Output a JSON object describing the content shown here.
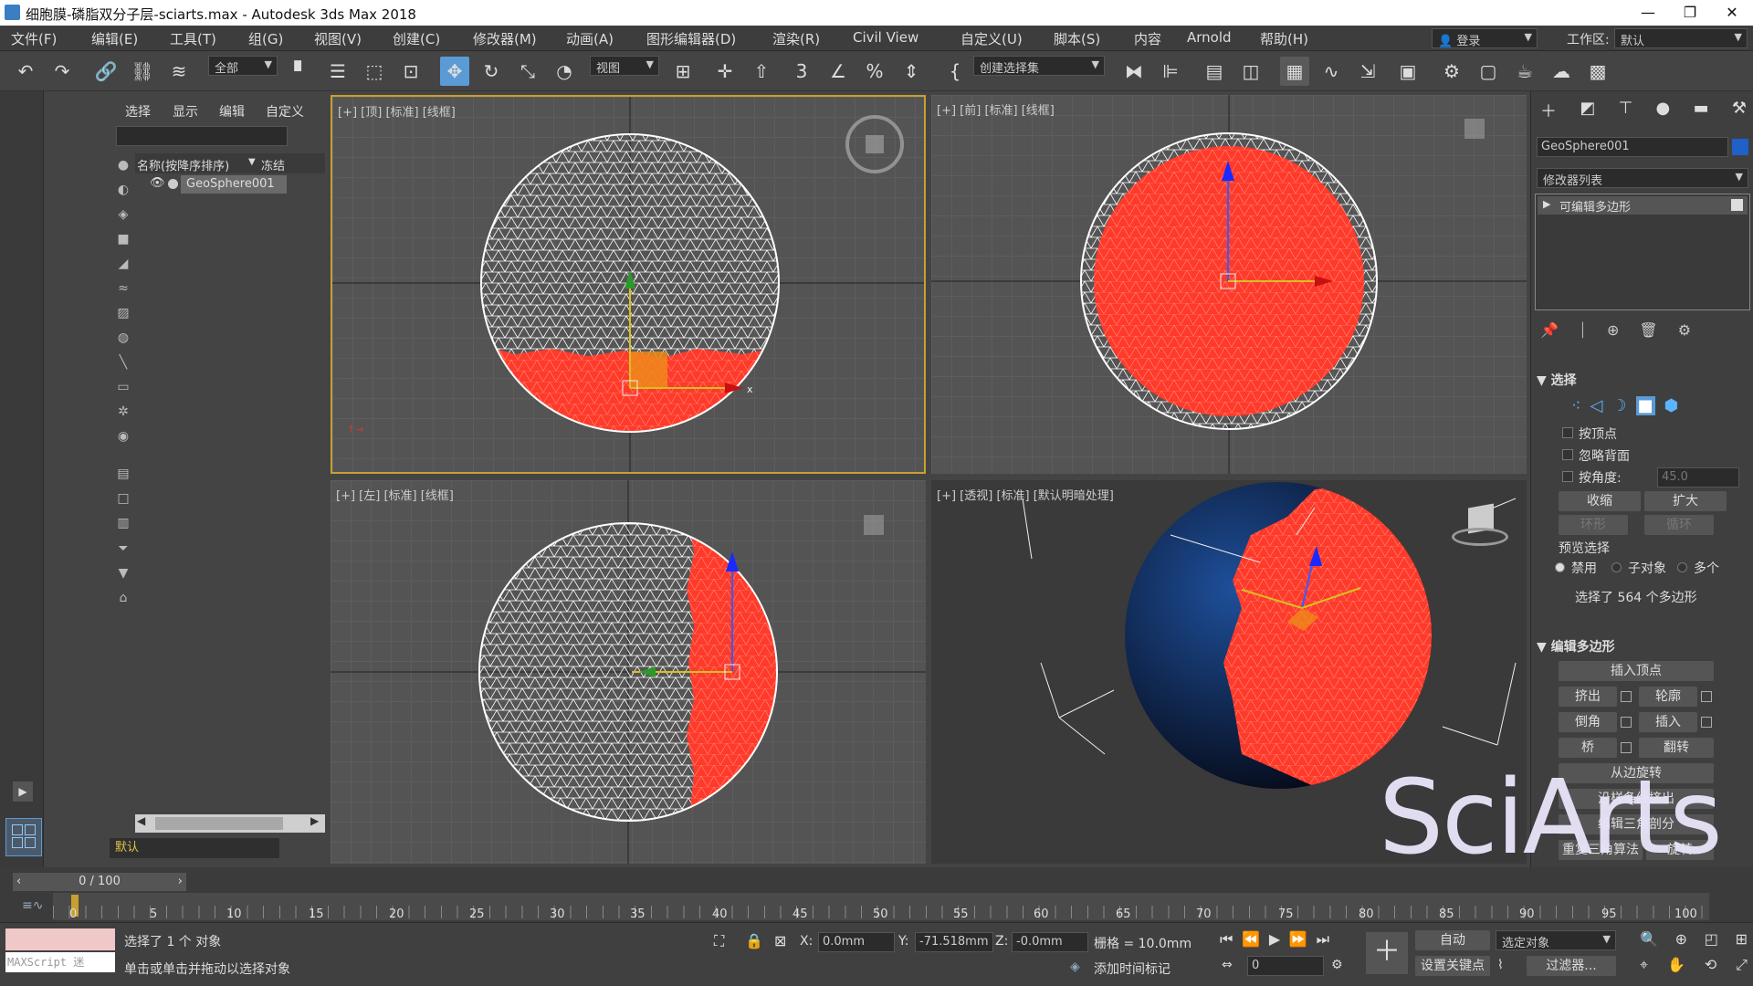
{
  "window": {
    "title": "细胞膜-磷脂双分子层-sciarts.max - Autodesk 3ds Max 2018",
    "minimize": "—",
    "maximize": "❐",
    "close": "✕"
  },
  "menu": [
    "文件(F)",
    "编辑(E)",
    "工具(T)",
    "组(G)",
    "视图(V)",
    "创建(C)",
    "修改器(M)",
    "动画(A)",
    "图形编辑器(D)",
    "渲染(R)",
    "Civil View",
    "自定义(U)",
    "脚本(S)",
    "内容",
    "Arnold",
    "帮助(H)"
  ],
  "account": {
    "label": "登录",
    "workspace_label": "工作区:",
    "workspace_value": "默认"
  },
  "toolbar": {
    "filter_value": "全部",
    "refcoord_value": "视图",
    "selset_placeholder": "创建选择集"
  },
  "scene": {
    "tabs": [
      "选择",
      "显示",
      "编辑",
      "自定义"
    ],
    "column_name": "名称(按降序排序)",
    "column_freeze": "冻结",
    "items": [
      "GeoSphere001"
    ],
    "layer": "默认"
  },
  "viewports": {
    "top": "[+] [顶] [标准] [线框]",
    "front": "[+] [前] [标准] [线框]",
    "left": "[+] [左] [标准] [线框]",
    "persp": "[+] [透视] [标准] [默认明暗处理]"
  },
  "cmd": {
    "object_name": "GeoSphere001",
    "modlist_label": "修改器列表",
    "stack_item": "可编辑多边形",
    "selection": {
      "title": "选择",
      "by_vertex": "按顶点",
      "ignore_back": "忽略背面",
      "by_angle": "按角度:",
      "angle_value": "45.0",
      "shrink": "收缩",
      "grow": "扩大",
      "ring": "环形",
      "loop": "循环",
      "preview_title": "预览选择",
      "preview_opts": [
        "禁用",
        "子对象",
        "多个"
      ],
      "status": "选择了 564 个多边形"
    },
    "edit_poly": {
      "title": "编辑多边形",
      "insert_vertex": "插入顶点",
      "extrude": "挤出",
      "outline": "轮廓",
      "bevel": "倒角",
      "inset": "插入",
      "bridge": "桥",
      "flip": "翻转",
      "hinge": "从边旋转",
      "extrude_spline": "沿样条线挤出",
      "edit_tri": "编辑三角剖分",
      "retri": "重复三角算法",
      "turn": "旋转"
    }
  },
  "timeline": {
    "frame": "0 / 100",
    "ticks": [
      "0",
      "5",
      "10",
      "15",
      "20",
      "25",
      "30",
      "35",
      "40",
      "45",
      "50",
      "55",
      "60",
      "65",
      "70",
      "75",
      "80",
      "85",
      "90",
      "95",
      "100"
    ]
  },
  "status": {
    "maxscript": "MAXScript 迷",
    "selected": "选择了 1 个 对象",
    "hint": "单击或单击并拖动以选择对象",
    "x_label": "X:",
    "x_value": "0.0mm",
    "y_label": "Y:",
    "y_value": "-71.518mm",
    "z_label": "Z:",
    "z_value": "-0.0mm",
    "grid": "栅格 = 10.0mm",
    "add_time_tag": "添加时间标记",
    "auto": "自动",
    "selected_obj": "选定对象",
    "set_key": "设置关键点",
    "filters": "过滤器...",
    "frame_field": "0"
  },
  "watermark": "SciArts",
  "colors": {
    "accent": "#5b9bd5",
    "selection": "#ff3a2a",
    "wire": "#ffffff"
  }
}
